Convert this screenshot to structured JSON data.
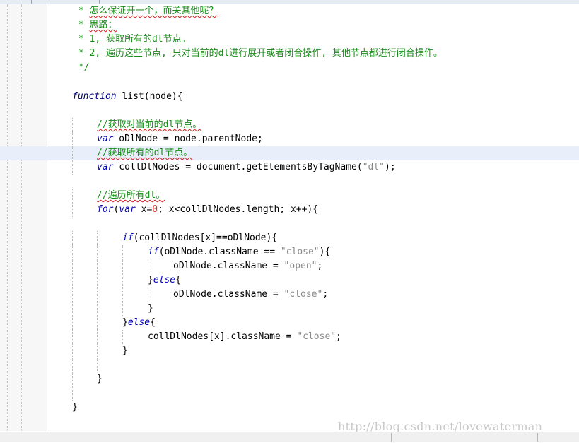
{
  "editor": {
    "lines": [
      {
        "indent": " * ",
        "text": "怎么保证开一个，而关其他呢？"
      },
      {
        "indent": " * ",
        "text": "思路："
      },
      {
        "indent": " * ",
        "text": "1, 获取所有的dl节点。"
      },
      {
        "indent": " * ",
        "text": "2, 遍历这些节点, 只对当前的dl进行展开或者闭合操作, 其他节点都进行闭合操作。"
      },
      {
        "indent": " */",
        "text": ""
      },
      {
        "kw": "function",
        "text": " list(node){"
      },
      {
        "text": "//获取对当前的dl节点。"
      },
      {
        "kw": "var",
        "text": " oDlNode = node.parentNode;"
      },
      {
        "text": "//获取所有的dl节点。"
      },
      {
        "kw": "var",
        "text": " collDlNodes = document.getElementsByTagName(",
        "str": "\"dl\"",
        "tail": ");"
      },
      {
        "text": "//遍历所有dl。"
      },
      {
        "kw": "for",
        "kw2": "var",
        "text": " x=",
        "num": "0",
        "tail": "; x<collDlNodes.length; x++){"
      },
      {
        "kw": "if",
        "text": "(collDlNodes[x]==oDlNode){"
      },
      {
        "kw": "if",
        "text": "(oDlNode.className == ",
        "str": "\"close\"",
        "tail": "){"
      },
      {
        "text": "oDlNode.className = ",
        "str": "\"open\"",
        "tail": ";"
      },
      {
        "pre": "}",
        "kw": "else",
        "text": "{"
      },
      {
        "text": "oDlNode.className = ",
        "str": "\"close\"",
        "tail": ";"
      },
      {
        "text": "}"
      },
      {
        "pre": "}",
        "kw": "else",
        "text": "{"
      },
      {
        "text": "collDlNodes[x].className = ",
        "str": "\"close\"",
        "tail": ";"
      },
      {
        "text": "}"
      },
      {
        "text": "}"
      },
      {
        "text": "}"
      }
    ]
  },
  "watermark": "http://blog.csdn.net/lovewaterman",
  "colors": {
    "keyword": "#0000b4",
    "comment": "#1a8c1a",
    "string": "#8a8a8a",
    "number": "#ff2020",
    "current_line": "#e8eefa"
  }
}
